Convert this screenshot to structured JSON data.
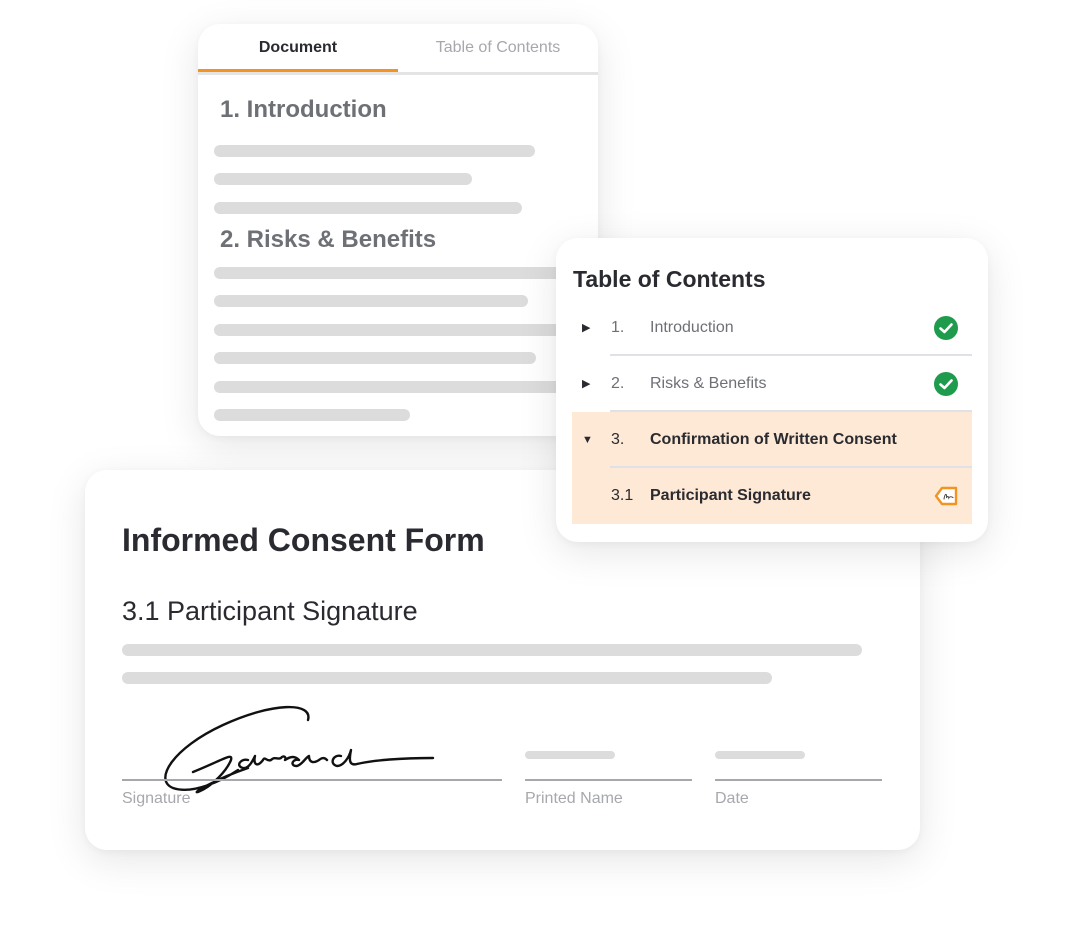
{
  "document_panel": {
    "tabs": [
      {
        "label": "Document",
        "active": true
      },
      {
        "label": "Table of Contents",
        "active": false
      }
    ],
    "sections": [
      {
        "heading": "1. Introduction",
        "placeholder_lines": 3
      },
      {
        "heading": "2. Risks & Benefits",
        "placeholder_lines": 6
      }
    ]
  },
  "toc_panel": {
    "title": "Table of Contents",
    "items": [
      {
        "number": "1.",
        "label": "Introduction",
        "expanded": false,
        "status": "complete",
        "status_icon": "check-circle-icon"
      },
      {
        "number": "2.",
        "label": "Risks & Benefits",
        "expanded": false,
        "status": "complete",
        "status_icon": "check-circle-icon"
      },
      {
        "number": "3.",
        "label": "Confirmation of Written Consent",
        "expanded": true,
        "status": "active",
        "status_icon": ""
      },
      {
        "number": "3.1",
        "label": "Participant Signature",
        "expanded": false,
        "status": "sign-here",
        "status_icon": "signature-tag-icon"
      }
    ]
  },
  "form": {
    "title": "Informed Consent Form",
    "subtitle": "3.1 Participant Signature",
    "fields": [
      {
        "label": "Signature",
        "value": "Edward",
        "kind": "handwritten-signature"
      },
      {
        "label": "Printed Name",
        "value": ""
      },
      {
        "label": "Date",
        "value": ""
      }
    ]
  },
  "colors": {
    "accent": "#f39321",
    "complete": "#1e9b4d",
    "highlight_bg": "#fde9d6",
    "placeholder": "#dcdcdc"
  }
}
